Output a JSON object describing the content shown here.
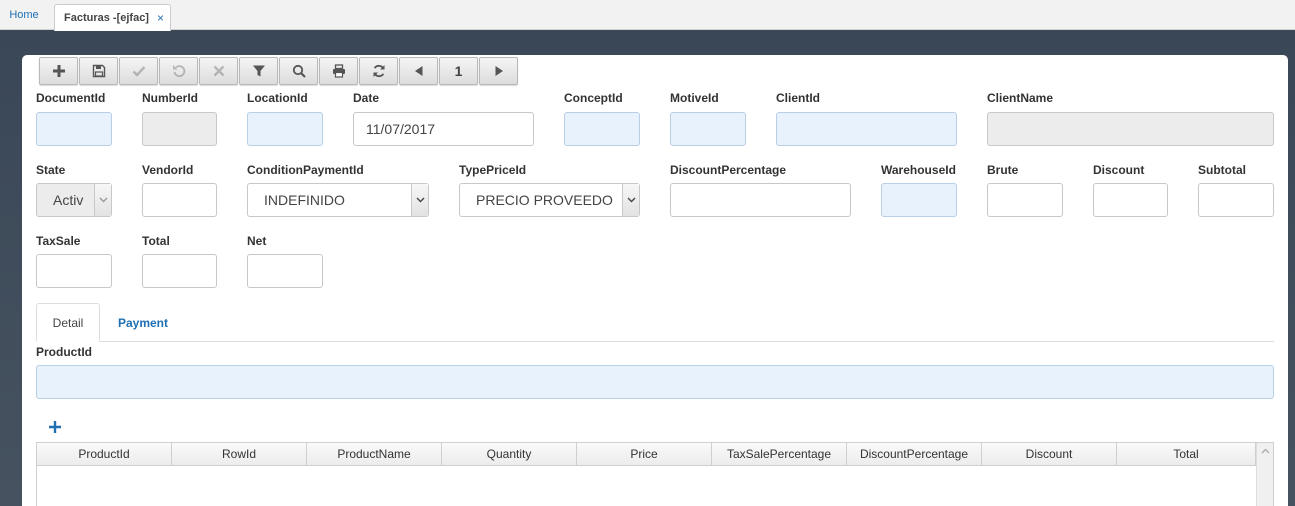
{
  "tabs": {
    "home_label": "Home",
    "active_label": "Facturas -[ejfac]",
    "close_glyph": "×"
  },
  "toolbar": {
    "buttons": [
      "add-icon",
      "save-icon",
      "check-icon",
      "undo-icon",
      "cancel-icon",
      "filter-icon",
      "search-icon",
      "print-icon",
      "refresh-icon",
      "prev-icon",
      "page-number",
      "next-icon"
    ],
    "page_number": "1"
  },
  "form": {
    "document_id": {
      "label": "DocumentId",
      "value": ""
    },
    "number_id": {
      "label": "NumberId",
      "value": ""
    },
    "location_id": {
      "label": "LocationId",
      "value": ""
    },
    "date": {
      "label": "Date",
      "value": "11/07/2017"
    },
    "concept_id": {
      "label": "ConceptId",
      "value": ""
    },
    "motive_id": {
      "label": "MotiveId",
      "value": ""
    },
    "client_id": {
      "label": "ClientId",
      "value": ""
    },
    "client_name": {
      "label": "ClientName",
      "value": ""
    },
    "state": {
      "label": "State",
      "value": "Activ"
    },
    "vendor_id": {
      "label": "VendorId",
      "value": ""
    },
    "condition_payment_id": {
      "label": "ConditionPaymentId",
      "value": "INDEFINIDO"
    },
    "type_price_id": {
      "label": "TypePriceId",
      "value": "PRECIO PROVEEDO"
    },
    "discount_percentage": {
      "label": "DiscountPercentage",
      "value": ""
    },
    "warehouse_id": {
      "label": "WarehouseId",
      "value": ""
    },
    "brute": {
      "label": "Brute",
      "value": ""
    },
    "discount": {
      "label": "Discount",
      "value": ""
    },
    "subtotal": {
      "label": "Subtotal",
      "value": ""
    },
    "tax_sale": {
      "label": "TaxSale",
      "value": ""
    },
    "total": {
      "label": "Total",
      "value": ""
    },
    "net": {
      "label": "Net",
      "value": ""
    }
  },
  "detail_tabs": {
    "detail_label": "Detail",
    "payment_label": "Payment"
  },
  "detail": {
    "product_id_label": "ProductId",
    "product_id_value": ""
  },
  "grid": {
    "columns": [
      "ProductId",
      "RowId",
      "ProductName",
      "Quantity",
      "Price",
      "TaxSalePercentage",
      "DiscountPercentage",
      "Discount",
      "Total"
    ],
    "rows": []
  },
  "colors": {
    "accent": "#1f6fb2",
    "required_field_bg": "#e8f2fc",
    "readonly_field_bg": "#ececec"
  }
}
